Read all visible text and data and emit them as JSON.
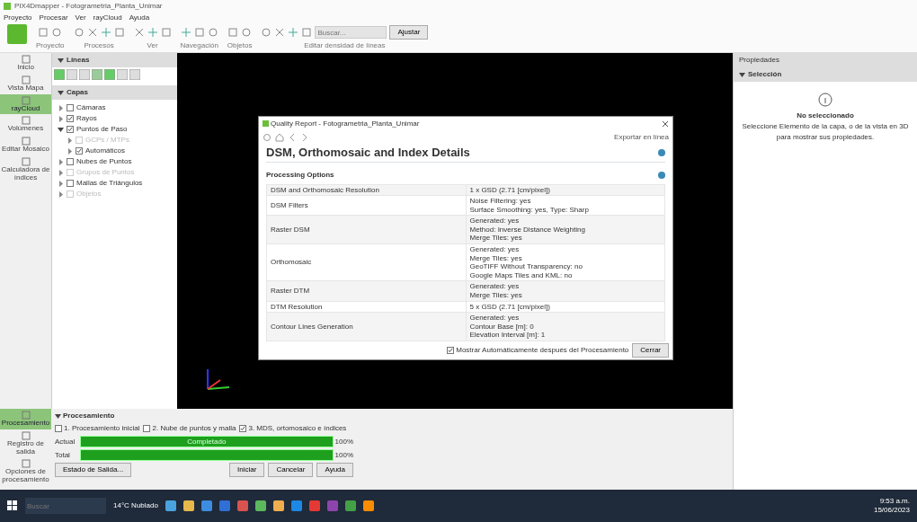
{
  "window": {
    "title": "PIX4Dmapper - Fotogrametria_Planta_Unimar"
  },
  "menu": [
    "Proyecto",
    "Procesar",
    "Ver",
    "rayCloud",
    "Ayuda"
  ],
  "toolbar": {
    "groups": [
      "Proyecto",
      "Procesos",
      "Ver",
      "Navegación",
      "Objetos",
      "Editar densidad de líneas"
    ],
    "search": {
      "placeholder": "Buscar..."
    },
    "search_button": "Ajustar"
  },
  "sidebar": {
    "items": [
      {
        "label": "Inicio",
        "selected": false
      },
      {
        "label": "Vista Mapa",
        "selected": false
      },
      {
        "label": "rayCloud",
        "selected": true
      },
      {
        "label": "Volúmenes",
        "selected": false
      },
      {
        "label": "Editar Mosaico",
        "selected": false
      },
      {
        "label": "Calculadora de índices",
        "selected": false
      }
    ],
    "bottom_items": [
      {
        "label": "Procesamiento",
        "selected": true
      },
      {
        "label": "Registro de salida",
        "selected": false
      },
      {
        "label": "Opciones de procesamiento",
        "selected": false
      }
    ]
  },
  "lines_panel": {
    "title": "Líneas"
  },
  "layers": {
    "title": "Capas",
    "items": [
      {
        "label": "Cámaras",
        "checked": false,
        "disabled": false
      },
      {
        "label": "Rayos",
        "checked": true,
        "disabled": false
      },
      {
        "label": "Puntos de Paso",
        "checked": true,
        "disabled": false,
        "expanded": true,
        "children": [
          {
            "label": "GCPs / MTPs",
            "checked": false,
            "disabled": true
          },
          {
            "label": "Automáticos",
            "checked": true,
            "disabled": false
          }
        ]
      },
      {
        "label": "Nubes de Puntos",
        "checked": false,
        "disabled": false
      },
      {
        "label": "Grupos de Puntos",
        "checked": false,
        "disabled": true
      },
      {
        "label": "Mallas de Triángulos",
        "checked": false,
        "disabled": false
      },
      {
        "label": "Objetos",
        "checked": false,
        "disabled": true
      }
    ]
  },
  "dialog": {
    "title": "Quality Report - Fotogrametria_Planta_Unimar",
    "export_label": "Exportar en línea",
    "heading": "DSM, Orthomosaic and Index Details",
    "section": "Processing Options",
    "rows": [
      {
        "name": "DSM and Orthomosaic Resolution",
        "value": [
          "1 x GSD (2.71 [cm/pixel])"
        ]
      },
      {
        "name": "DSM Filters",
        "value": [
          "Noise Filtering: yes",
          "Surface Smoothing: yes, Type: Sharp"
        ]
      },
      {
        "name": "Raster DSM",
        "value": [
          "Generated: yes",
          "Method: Inverse Distance Weighting",
          "Merge Tiles: yes"
        ]
      },
      {
        "name": "Orthomosaic",
        "value": [
          "Generated: yes",
          "Merge Tiles: yes",
          "GeoTIFF Without Transparency: no",
          "Google Maps Tiles and KML: no"
        ]
      },
      {
        "name": "Raster DTM",
        "value": [
          "Generated: yes",
          "Merge Tiles: yes"
        ]
      },
      {
        "name": "DTM Resolution",
        "value": [
          "5 x GSD (2.71 [cm/pixel])"
        ]
      },
      {
        "name": "Contour Lines Generation",
        "value": [
          "Generated: yes",
          "Contour Base [m]: 0",
          "Elevation Interval [m]: 1"
        ]
      }
    ],
    "auto_show": {
      "label": "Mostrar Automáticamente después del Procesamiento",
      "checked": true
    },
    "close_button": "Cerrar"
  },
  "properties": {
    "title": "Propiedades",
    "section": "Selección",
    "empty_title": "No seleccionado",
    "empty_text": "Seleccione Elemento de la capa, o de la vista en 3D para mostrar sus propiedades."
  },
  "processing": {
    "title": "Procesamiento",
    "steps": [
      {
        "label": "1. Procesamiento inicial",
        "checked": false
      },
      {
        "label": "2. Nube de puntos y malla",
        "checked": false
      },
      {
        "label": "3. MDS, ortomosaico e índices",
        "checked": true
      }
    ],
    "bars": [
      {
        "label": "Actual",
        "level": 1,
        "text": "Completado",
        "reading": "100%"
      },
      {
        "label": "Total",
        "level": 1,
        "reading": "100%"
      }
    ],
    "buttons": [
      "Estado de Salida...",
      "Iniciar",
      "Cancelar",
      "Ayuda"
    ]
  },
  "taskbar": {
    "search": {
      "placeholder": "Buscar"
    },
    "weather": "14°C Nublado",
    "time": "9:53 a.m.",
    "date": "15/06/2023"
  }
}
